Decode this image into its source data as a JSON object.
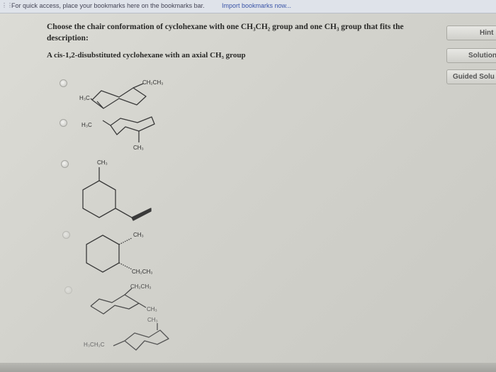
{
  "browser": {
    "bookmarks_text": "For quick access, place your bookmarks here on the bookmarks bar.",
    "bookmarks_link": "Import bookmarks now..."
  },
  "question": {
    "line1": "Choose the chair conformation of cyclohexane with one CH₃CH₂ group and one CH₃ group that fits the",
    "line2": "description:",
    "prompt": "A cis-1,2-disubstituted cyclohexane with an axial CH₃ group"
  },
  "buttons": {
    "hint": "Hint",
    "solution": "Solution",
    "guided": "Guided Solu"
  },
  "options": [
    {
      "labels": [
        "CH₂CH₃",
        "H₃C"
      ]
    },
    {
      "labels": [
        "H₃C",
        "CH₃"
      ]
    },
    {
      "labels": [
        "CH₃"
      ]
    },
    {
      "labels": [
        "CH₃",
        "CH₂CH₃"
      ]
    },
    {
      "labels": [
        "CH₂CH₃",
        "CH₃"
      ]
    },
    {
      "labels": [
        "CH₃",
        "H₃CH₂C"
      ]
    }
  ]
}
